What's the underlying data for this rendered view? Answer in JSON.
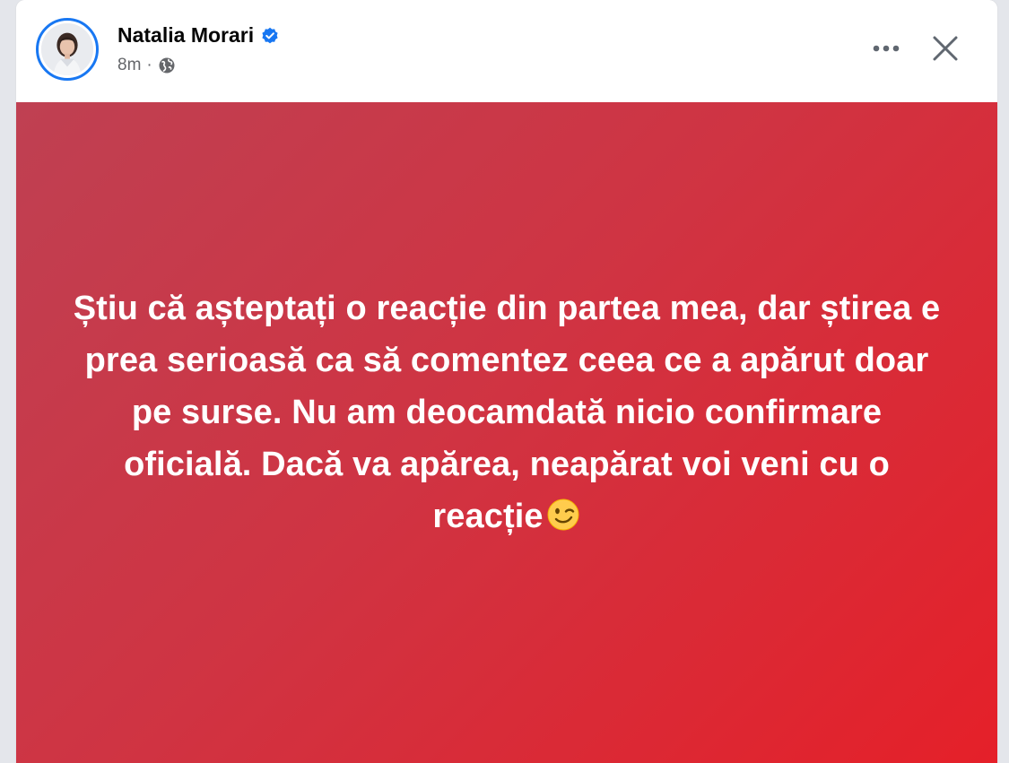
{
  "post": {
    "author": "Natalia Morari",
    "timestamp": "8m",
    "separator": "·",
    "audience_icon": "globe-icon",
    "verified_icon": "verified-badge-icon",
    "more_icon": "more-options-icon",
    "close_icon": "close-icon",
    "text": "Știu că așteptați o reacție din partea mea, dar știrea e prea serioasă ca să comentez ceea ce a apărut doar pe surse. Nu am deocamdată nicio confirmare oficială. Dacă va apărea, neapărat voi veni cu o reacție",
    "emoji": "winking-face-emoji",
    "colors": {
      "accent": "#1877f2",
      "card_gradient_start": "#bf4052",
      "card_gradient_end": "#e52029",
      "meta_text": "#65676b"
    }
  }
}
